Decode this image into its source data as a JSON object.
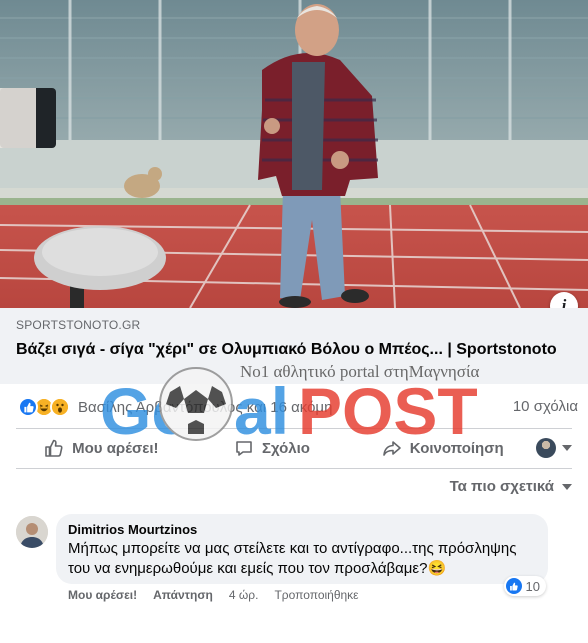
{
  "post": {
    "link_domain": "SPORTSTONOTO.GR",
    "link_title": "Βάζει σιγά - σίγα \"χέρι\" σε Ολυμπιακό Βόλου ο Μπέος... | Sportstonoto",
    "info_glyph": "i"
  },
  "watermark": {
    "tagline": "Νο1 αθλητικό portal στηΜαγνησία",
    "logo_text_left": "Go",
    "logo_text_mid": "al",
    "logo_text_right": "POST"
  },
  "reactions": {
    "icons": [
      "like",
      "haha",
      "wow"
    ],
    "reactors_text": "Βασίλης Αρβαντόπουλος και 16 ακόμη",
    "comments_count": "10 σχόλια"
  },
  "actions": {
    "like_label": "Μου αρέσει!",
    "comment_label": "Σχόλιο",
    "share_label": "Κοινοποίηση"
  },
  "sort": {
    "label": "Τα πιο σχετικά"
  },
  "comment": {
    "author": "Dimitrios Mourtzinos",
    "text": "Μήπως μπορείτε να μας στείλετε και το αντίγραφο...της πρόσληψης του να ενημερωθούμε και εμείς που τον προσλάβαμε?😆",
    "reaction_count": "10",
    "like_label": "Μου αρέσει!",
    "reply_label": "Απάντηση",
    "time": "4 ώρ.",
    "edited_label": "Τροποποιήθηκε"
  },
  "colors": {
    "facebook_blue": "#1877f2",
    "secondary_text": "#65676b",
    "watermark_red": "#e63b2e",
    "watermark_blue": "#2f8fe0"
  }
}
